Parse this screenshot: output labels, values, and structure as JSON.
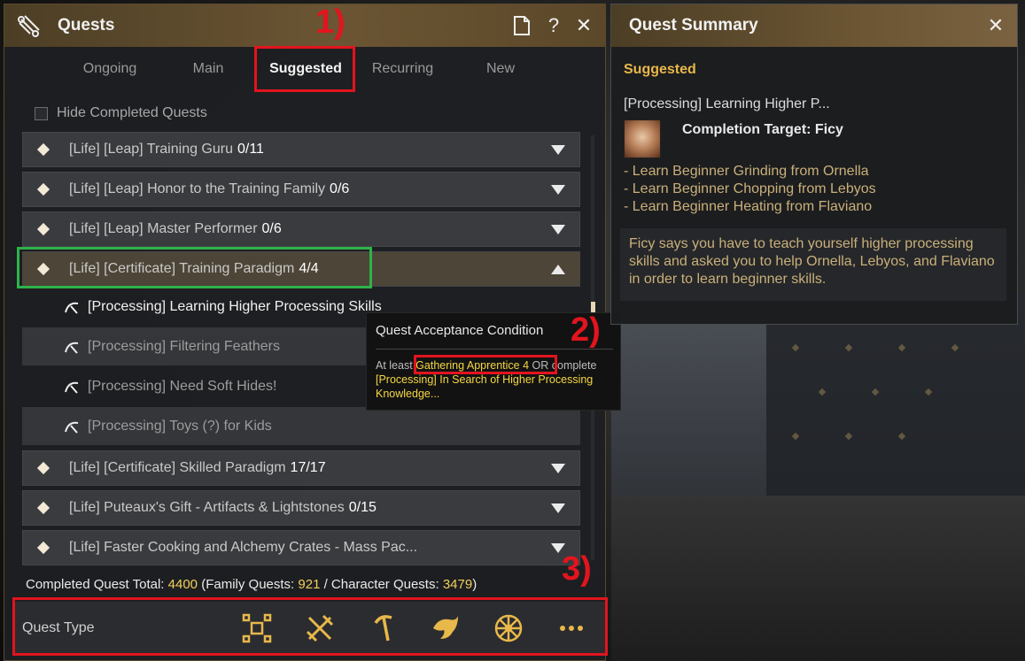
{
  "quests_window": {
    "title": "Quests",
    "tabs": [
      "Ongoing",
      "Main",
      "Suggested",
      "Recurring",
      "New"
    ],
    "active_tab": "Suggested",
    "hide_completed_label": "Hide Completed Quests",
    "quest_groups": [
      {
        "title": "[Life] [Leap] Training Guru",
        "count": "0/11"
      },
      {
        "title": "[Life] [Leap] Honor to the Training Family",
        "count": "0/6"
      },
      {
        "title": "[Life] [Leap] Master Performer",
        "count": "0/6"
      },
      {
        "title": "[Life] [Certificate] Training Paradigm",
        "count": "4/4"
      },
      {
        "title": "[Life] [Certificate] Skilled Paradigm",
        "count": "17/17"
      },
      {
        "title": "[Life] Puteaux's Gift - Artifacts & Lightstones",
        "count": "0/15"
      },
      {
        "title": "[Life] Faster Cooking and Alchemy Crates - Mass Pac...",
        "count": ""
      }
    ],
    "sub_quests": [
      "[Processing] Learning Higher Processing Skills",
      "[Processing] Filtering Feathers",
      "[Processing] Need Soft Hides!",
      "[Processing] Toys (?) for Kids"
    ],
    "totals": {
      "label_completed": "Completed Quest Total: ",
      "completed": "4400",
      "label_family": " (Family Quests: ",
      "family": "921",
      "label_character": " / Character Quests: ",
      "character": "3479",
      "close_paren": ")"
    },
    "quest_type_label": "Quest Type",
    "quest_type_icons": [
      "combat-icon",
      "swords-icon",
      "pickaxe-icon",
      "fish-icon",
      "wheel-icon",
      "more-icon"
    ]
  },
  "tooltip": {
    "title": "Quest Acceptance Condition",
    "line_prefix": "At least ",
    "requirement": "Gathering Apprentice 4",
    "line_mid": " OR complete ",
    "quest_ref": "[Processing] In Search of Higher Processing Knowledge..."
  },
  "summary_window": {
    "title": "Quest Summary",
    "category": "Suggested",
    "quest_name": "[Processing] Learning Higher P...",
    "completion_target": "Completion Target: Ficy",
    "objectives": [
      "- Learn Beginner Grinding from Ornella",
      "- Learn Beginner Chopping from Lebyos",
      "- Learn Beginner Heating from Flaviano"
    ],
    "description": "Ficy says you have to teach yourself higher processing skills and asked you to help Ornella, Lebyos, and Flaviano in order to learn beginner skills."
  },
  "annotations": {
    "one": "1)",
    "two": "2)",
    "three": "3)"
  },
  "colors": {
    "accent_gold": "#e8b84a",
    "highlight_yellow": "#f5d742",
    "annotation_red": "#e2141e",
    "annotation_green": "#2db34a"
  }
}
